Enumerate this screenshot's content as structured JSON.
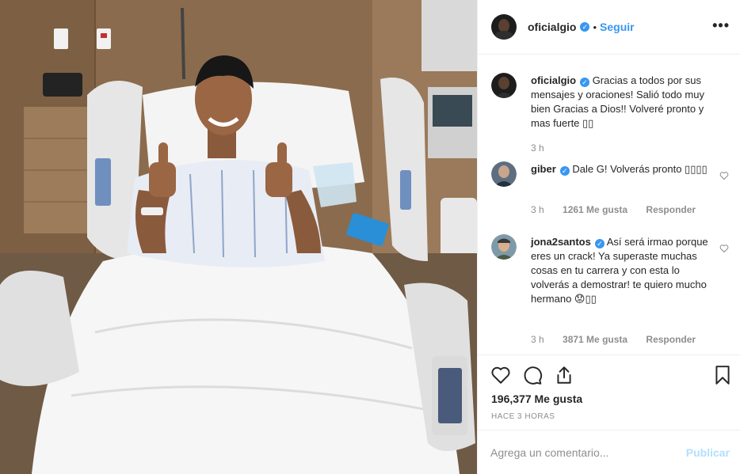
{
  "post": {
    "author": "oficialgio",
    "verified_symbol": "✓",
    "separator": "•",
    "follow_label": "Seguir",
    "more_label": "•••"
  },
  "comments": [
    {
      "user": "oficialgio",
      "text": "Gracias a todos por sus mensajes y oraciones! Salió todo muy bien Gracias a Dios!! Volveré pronto y mas fuerte ▯▯",
      "time": "3 h",
      "likes": "",
      "reply": ""
    },
    {
      "user": "giber",
      "text": "Dale G! Volverás pronto ▯▯▯▯",
      "time": "3 h",
      "likes": "1261 Me gusta",
      "reply": "Responder"
    },
    {
      "user": "jona2santos",
      "text": "Así será irmao porque eres un crack! Ya superaste muchas cosas en tu carrera y con esta lo volverás a demostrar! te quiero mucho hermano 😟▯▯",
      "time": "3 h",
      "likes": "3871 Me gusta",
      "reply": "Responder"
    }
  ],
  "engagement": {
    "likes_count": "196,377 Me gusta",
    "posted_ago": "HACE 3 HORAS"
  },
  "comment_box": {
    "placeholder": "Agrega un comentario...",
    "publish_label": "Publicar"
  },
  "icons": {
    "like": "heart-icon",
    "comment": "comment-bubble-icon",
    "share": "share-icon",
    "save": "bookmark-icon",
    "options": "more-options-icon",
    "verified": "verified-badge-icon"
  },
  "colors": {
    "link": "#3897f0",
    "muted": "#8e8e8e",
    "text": "#262626",
    "publish_disabled": "#b2dffc",
    "border": "#efefef"
  }
}
